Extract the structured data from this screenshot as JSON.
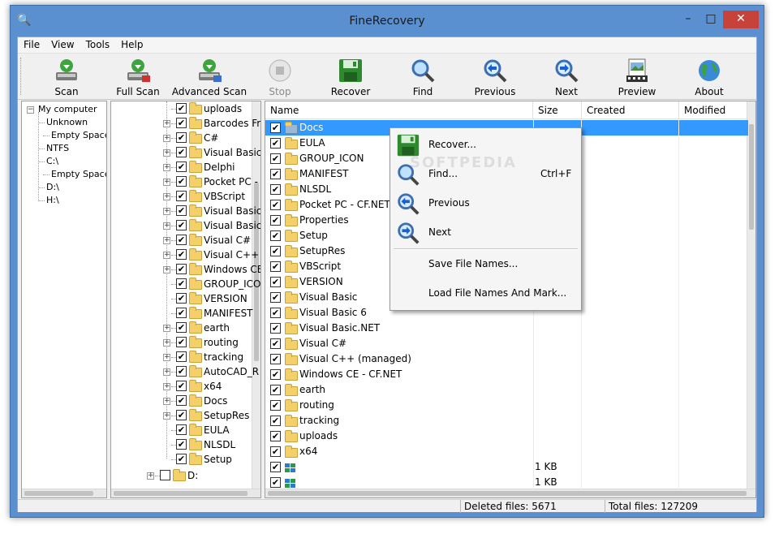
{
  "window": {
    "title": "FineRecovery"
  },
  "menu": [
    "File",
    "View",
    "Tools",
    "Help"
  ],
  "toolbar": [
    {
      "label": "Scan",
      "icon": "scan-icon",
      "enabled": true
    },
    {
      "label": "Full Scan",
      "icon": "full-scan-icon",
      "enabled": true
    },
    {
      "label": "Advanced Scan",
      "icon": "advanced-scan-icon",
      "enabled": true
    },
    {
      "label": "Stop",
      "icon": "stop-icon",
      "enabled": false
    },
    {
      "label": "Recover",
      "icon": "floppy-disk-icon",
      "enabled": true
    },
    {
      "label": "Find",
      "icon": "magnifier-icon",
      "enabled": true
    },
    {
      "label": "Previous",
      "icon": "previous-arrow-icon",
      "enabled": true
    },
    {
      "label": "Next",
      "icon": "next-arrow-icon",
      "enabled": true
    },
    {
      "label": "Preview",
      "icon": "preview-film-icon",
      "enabled": true
    },
    {
      "label": "About",
      "icon": "globe-icon",
      "enabled": true
    }
  ],
  "drive_tree": [
    {
      "label": "My computer",
      "expandable": true,
      "level": 0
    },
    {
      "label": "Unknown",
      "level": 1
    },
    {
      "label": "Empty Space",
      "level": 2
    },
    {
      "label": "NTFS",
      "level": 1
    },
    {
      "label": "C:\\",
      "level": 1
    },
    {
      "label": "Empty Space",
      "level": 2
    },
    {
      "label": "D:\\",
      "level": 1
    },
    {
      "label": "H:\\",
      "level": 1
    }
  ],
  "folder_tree": [
    {
      "label": "uploads",
      "expandable": false,
      "checked": true
    },
    {
      "label": "Barcodes Fre",
      "expandable": true,
      "checked": true
    },
    {
      "label": "C#",
      "expandable": true,
      "checked": true
    },
    {
      "label": "Visual Basic",
      "expandable": true,
      "checked": true
    },
    {
      "label": "Delphi",
      "expandable": true,
      "checked": true
    },
    {
      "label": "Pocket PC -",
      "expandable": true,
      "checked": true
    },
    {
      "label": "VBScript",
      "expandable": true,
      "checked": true
    },
    {
      "label": "Visual Basic",
      "expandable": true,
      "checked": true
    },
    {
      "label": "Visual Basic.",
      "expandable": true,
      "checked": true
    },
    {
      "label": "Visual C#",
      "expandable": true,
      "checked": true
    },
    {
      "label": "Visual C++ (",
      "expandable": true,
      "checked": true
    },
    {
      "label": "Windows CE",
      "expandable": true,
      "checked": true
    },
    {
      "label": "GROUP_ICO",
      "expandable": false,
      "checked": true
    },
    {
      "label": "VERSION",
      "expandable": false,
      "checked": true
    },
    {
      "label": "MANIFEST",
      "expandable": false,
      "checked": true
    },
    {
      "label": "earth",
      "expandable": true,
      "checked": true
    },
    {
      "label": "routing",
      "expandable": true,
      "checked": true
    },
    {
      "label": "tracking",
      "expandable": true,
      "checked": true
    },
    {
      "label": "AutoCAD_R",
      "expandable": true,
      "checked": true
    },
    {
      "label": "x64",
      "expandable": true,
      "checked": true
    },
    {
      "label": "Docs",
      "expandable": true,
      "checked": true
    },
    {
      "label": "SetupRes",
      "expandable": true,
      "checked": true
    },
    {
      "label": "EULA",
      "expandable": false,
      "checked": true
    },
    {
      "label": "NLSDL",
      "expandable": false,
      "checked": true
    },
    {
      "label": "Setup",
      "expandable": false,
      "checked": true
    },
    {
      "label": "D:",
      "expandable": true,
      "checked": false,
      "root": true
    }
  ],
  "file_list": {
    "columns": [
      "Name",
      "Size",
      "Created",
      "Modified"
    ],
    "rows": [
      {
        "name": "Docs",
        "size": "",
        "type": "folder",
        "selected": true
      },
      {
        "name": "EULA",
        "size": "",
        "type": "folder"
      },
      {
        "name": "GROUP_ICON",
        "size": "",
        "type": "folder"
      },
      {
        "name": "MANIFEST",
        "size": "",
        "type": "folder"
      },
      {
        "name": "NLSDL",
        "size": "",
        "type": "folder"
      },
      {
        "name": "Pocket PC - CF.NET",
        "size": "",
        "type": "folder"
      },
      {
        "name": "Properties",
        "size": "",
        "type": "folder"
      },
      {
        "name": "Setup",
        "size": "",
        "type": "folder"
      },
      {
        "name": "SetupRes",
        "size": "",
        "type": "folder"
      },
      {
        "name": "VBScript",
        "size": "",
        "type": "folder"
      },
      {
        "name": "VERSION",
        "size": "",
        "type": "folder"
      },
      {
        "name": "Visual Basic",
        "size": "",
        "type": "folder"
      },
      {
        "name": "Visual Basic 6",
        "size": "",
        "type": "folder"
      },
      {
        "name": "Visual Basic.NET",
        "size": "",
        "type": "folder"
      },
      {
        "name": "Visual C#",
        "size": "",
        "type": "folder"
      },
      {
        "name": "Visual C++ (managed)",
        "size": "",
        "type": "folder"
      },
      {
        "name": "Windows CE - CF.NET",
        "size": "",
        "type": "folder"
      },
      {
        "name": "earth",
        "size": "",
        "type": "folder"
      },
      {
        "name": "routing",
        "size": "",
        "type": "folder"
      },
      {
        "name": "tracking",
        "size": "",
        "type": "folder"
      },
      {
        "name": "uploads",
        "size": "",
        "type": "folder"
      },
      {
        "name": "x64",
        "size": "",
        "type": "folder"
      },
      {
        "name": "",
        "size": "1 KB",
        "type": "file"
      },
      {
        "name": "",
        "size": "1 KB",
        "type": "file"
      }
    ]
  },
  "context_menu": [
    {
      "label": "Recover...",
      "shortcut": "",
      "icon": "floppy-disk-icon"
    },
    {
      "label": "Find...",
      "shortcut": "Ctrl+F",
      "icon": "magnifier-icon"
    },
    {
      "label": "Previous",
      "shortcut": "",
      "icon": "previous-arrow-icon"
    },
    {
      "label": "Next",
      "shortcut": "",
      "icon": "next-arrow-icon"
    },
    {
      "label": "Save File Names...",
      "shortcut": ""
    },
    {
      "label": "Load File Names And Mark...",
      "shortcut": ""
    }
  ],
  "status": {
    "deleted": "Deleted files: 5671",
    "total": "Total files: 127209"
  },
  "watermark": "SOFTPEDIA",
  "colors": {
    "selection": "#3399ff",
    "titlebar": "#5a8fd0",
    "close": "#c7423b",
    "folder": "#f3d069"
  }
}
